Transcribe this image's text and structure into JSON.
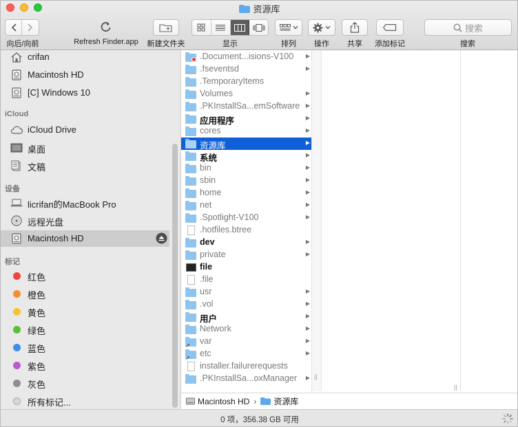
{
  "window": {
    "title": "资源库"
  },
  "toolbar": {
    "back_forward_label": "向后/向前",
    "refresh_label": "Refresh Finder.app",
    "new_folder_label": "新建文件夹",
    "view_label": "显示",
    "arrange_label": "排列",
    "action_label": "操作",
    "share_label": "共享",
    "tag_label": "添加标记",
    "search_label": "搜索",
    "search_placeholder": "搜索"
  },
  "sidebar": {
    "top_items": [
      {
        "label": "crifan",
        "icon": "home-icon"
      },
      {
        "label": "Macintosh HD",
        "icon": "disk-icon"
      },
      {
        "label": "[C] Windows 10",
        "icon": "disk-icon"
      }
    ],
    "icloud_header": "iCloud",
    "icloud_items": [
      {
        "label": "iCloud Drive",
        "icon": "cloud-icon"
      },
      {
        "label": "桌面",
        "icon": "desktop-icon"
      },
      {
        "label": "文稿",
        "icon": "documents-icon"
      }
    ],
    "devices_header": "设备",
    "device_items": [
      {
        "label": "licrifan的MacBook Pro",
        "icon": "laptop-icon"
      },
      {
        "label": "远程光盘",
        "icon": "optical-disc-icon"
      },
      {
        "label": "Macintosh HD",
        "icon": "disk-icon"
      }
    ],
    "tags_header": "标记",
    "tags": [
      {
        "label": "红色",
        "color": "#f0433a"
      },
      {
        "label": "橙色",
        "color": "#f4912d"
      },
      {
        "label": "黄色",
        "color": "#f5c431"
      },
      {
        "label": "绿色",
        "color": "#58c03b"
      },
      {
        "label": "蓝色",
        "color": "#3d8fe8"
      },
      {
        "label": "紫色",
        "color": "#b95ad0"
      },
      {
        "label": "灰色",
        "color": "#8e8e8e"
      },
      {
        "label": "所有标记...",
        "color": "#d8d8d8"
      }
    ]
  },
  "column1": [
    {
      "name": ".Document...isions-V100",
      "kind": "folder-lock",
      "gray": true,
      "arrow": true
    },
    {
      "name": ".fseventsd",
      "kind": "folder",
      "gray": true,
      "arrow": true
    },
    {
      "name": ".TemporaryItems",
      "kind": "folder",
      "gray": true,
      "arrow": false
    },
    {
      "name": "Volumes",
      "kind": "folder",
      "gray": true,
      "arrow": true
    },
    {
      "name": ".PKInstallSa...emSoftware",
      "kind": "folder",
      "gray": true,
      "arrow": true
    },
    {
      "name": "应用程序",
      "kind": "folder",
      "bold": true,
      "arrow": true
    },
    {
      "name": "cores",
      "kind": "folder",
      "gray": true,
      "arrow": true
    },
    {
      "name": "资源库",
      "kind": "folder",
      "selected": true,
      "arrow": true
    },
    {
      "name": "系统",
      "kind": "folder",
      "bold": true,
      "arrow": true
    },
    {
      "name": "bin",
      "kind": "folder",
      "gray": true,
      "arrow": true
    },
    {
      "name": "sbin",
      "kind": "folder",
      "gray": true,
      "arrow": true
    },
    {
      "name": "home",
      "kind": "folder",
      "gray": true,
      "arrow": true
    },
    {
      "name": "net",
      "kind": "folder",
      "gray": true,
      "arrow": true
    },
    {
      "name": ".Spotlight-V100",
      "kind": "folder",
      "gray": true,
      "arrow": true
    },
    {
      "name": ".hotfiles.btree",
      "kind": "doc",
      "gray": true,
      "arrow": false
    },
    {
      "name": "dev",
      "kind": "folder",
      "bold": true,
      "arrow": true
    },
    {
      "name": "private",
      "kind": "folder",
      "gray": true,
      "arrow": true
    },
    {
      "name": "file",
      "kind": "exec",
      "bold": true,
      "arrow": false
    },
    {
      "name": ".file",
      "kind": "doc",
      "gray": true,
      "arrow": false
    },
    {
      "name": "usr",
      "kind": "folder",
      "gray": true,
      "arrow": true
    },
    {
      "name": ".vol",
      "kind": "folder",
      "gray": true,
      "arrow": true
    },
    {
      "name": "用户",
      "kind": "folder",
      "bold": true,
      "arrow": true
    },
    {
      "name": "Network",
      "kind": "folder",
      "gray": true,
      "arrow": true
    },
    {
      "name": "var",
      "kind": "folder-alias",
      "gray": true,
      "arrow": true
    },
    {
      "name": "etc",
      "kind": "folder-alias",
      "gray": true,
      "arrow": true
    },
    {
      "name": "installer.failurerequests",
      "kind": "doc",
      "gray": true,
      "arrow": false
    },
    {
      "name": ".PKInstallSa...oxManager",
      "kind": "folder",
      "gray": true,
      "arrow": true
    }
  ],
  "pathbar": {
    "disk": "Macintosh HD",
    "separator": "›",
    "folder": "资源库"
  },
  "status": {
    "text": "0 项，356.38 GB 可用"
  }
}
